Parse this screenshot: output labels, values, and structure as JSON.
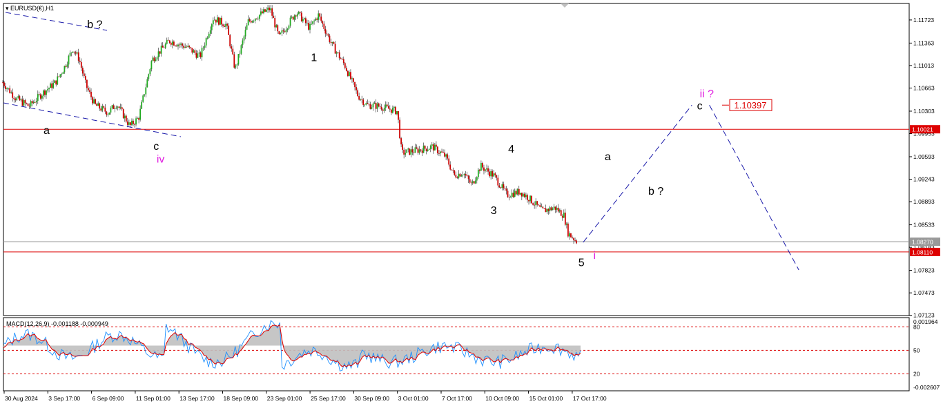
{
  "symbol_title": "EURUSD(€),H1",
  "macd_title": "MACD(12,26,9) -0.001188 -0.000949",
  "chart_data": [
    {
      "type": "candlestick",
      "title": "EURUSD(€),H1",
      "y_ticks": [
        "1.11723",
        "1.11363",
        "1.11013",
        "1.10663",
        "1.10303",
        "1.09953",
        "1.09593",
        "1.09243",
        "1.08893",
        "1.08533",
        "1.08183",
        "1.07823",
        "1.07473",
        "1.07123"
      ],
      "ylim": [
        1.0712,
        1.1198
      ],
      "x_ticks": [
        "30 Aug 2024",
        "3 Sep 17:00",
        "6 Sep 09:00",
        "11 Sep 01:00",
        "13 Sep 17:00",
        "18 Sep 09:00",
        "23 Sep 01:00",
        "25 Sep 17:00",
        "30 Sep 09:00",
        "3 Oct 01:00",
        "7 Oct 17:00",
        "10 Oct 09:00",
        "15 Oct 01:00",
        "17 Oct 17:00"
      ],
      "price_path": [
        [
          0,
          1.1075
        ],
        [
          1.5,
          1.105
        ],
        [
          3,
          1.1038
        ],
        [
          4.5,
          1.1058
        ],
        [
          6,
          1.1075
        ],
        [
          7,
          1.1098
        ],
        [
          8,
          1.1128
        ],
        [
          8.7,
          1.1112
        ],
        [
          9.5,
          1.107
        ],
        [
          10.5,
          1.104
        ],
        [
          12,
          1.1028
        ],
        [
          13,
          1.1042
        ],
        [
          14.5,
          1.1007
        ],
        [
          15.5,
          1.102
        ],
        [
          17,
          1.111
        ],
        [
          19,
          1.114
        ],
        [
          21,
          1.113
        ],
        [
          22.5,
          1.1115
        ],
        [
          24,
          1.1175
        ],
        [
          25.5,
          1.1165
        ],
        [
          26.5,
          1.1095
        ],
        [
          28,
          1.117
        ],
        [
          30.5,
          1.119
        ],
        [
          31.5,
          1.1145
        ],
        [
          33.5,
          1.1185
        ],
        [
          35,
          1.116
        ],
        [
          36,
          1.118
        ],
        [
          37.5,
          1.1135
        ],
        [
          39,
          1.1102
        ],
        [
          40.5,
          1.1055
        ],
        [
          41.5,
          1.104
        ],
        [
          43,
          1.1038
        ],
        [
          45,
          1.103
        ],
        [
          45.5,
          1.0965
        ],
        [
          47.5,
          1.097
        ],
        [
          49,
          1.0975
        ],
        [
          50.5,
          1.096
        ],
        [
          51.5,
          1.093
        ],
        [
          52.5,
          1.0935
        ],
        [
          53.5,
          1.0915
        ],
        [
          54.5,
          1.0945
        ],
        [
          56,
          1.093
        ],
        [
          57.5,
          1.09
        ],
        [
          59,
          1.0905
        ],
        [
          60,
          1.0895
        ],
        [
          61.5,
          1.0875
        ],
        [
          63,
          1.088
        ],
        [
          64,
          1.0868
        ],
        [
          64.5,
          1.084
        ],
        [
          65.5,
          1.0827
        ]
      ],
      "horizontal_levels": [
        {
          "price": 1.10021,
          "label": "1.10021",
          "color": "#dd0000"
        },
        {
          "price": 1.0811,
          "label": "1.08110",
          "color": "#dd0000"
        },
        {
          "price": 1.0827,
          "label": "1.08270",
          "color": "#999999"
        }
      ],
      "target_label": "1.10397",
      "wave_labels": [
        {
          "text": "b ?",
          "x": 10.5,
          "price": 1.116,
          "color": "#000000"
        },
        {
          "text": "a",
          "x": 5,
          "price": 1.0995,
          "color": "#000000"
        },
        {
          "text": "c",
          "x": 17.5,
          "price": 1.097,
          "color": "#000000"
        },
        {
          "text": "iv",
          "x": 18,
          "price": 1.095,
          "color": "#e020e0"
        },
        {
          "text": "1",
          "x": 35.5,
          "price": 1.1108,
          "color": "#000000"
        },
        {
          "text": "4",
          "x": 58,
          "price": 1.0966,
          "color": "#000000"
        },
        {
          "text": "3",
          "x": 56,
          "price": 1.087,
          "color": "#000000"
        },
        {
          "text": "5",
          "x": 66,
          "price": 1.0789,
          "color": "#000000"
        },
        {
          "text": "i",
          "x": 67.5,
          "price": 1.08,
          "color": "#e020e0"
        },
        {
          "text": "a",
          "x": 69,
          "price": 1.0954,
          "color": "#000000"
        },
        {
          "text": "b ?",
          "x": 74.5,
          "price": 1.09,
          "color": "#000000"
        },
        {
          "text": "c",
          "x": 79.5,
          "price": 1.1033,
          "color": "#000000"
        },
        {
          "text": "ii ?",
          "x": 80.3,
          "price": 1.1052,
          "color": "#e020e0"
        }
      ]
    },
    {
      "type": "line",
      "title": "MACD(12,26,9) -0.001188 -0.000949",
      "y_ticks": [
        "0.001964",
        "80",
        "50",
        "20",
        "-0.002607"
      ],
      "levels": [
        80,
        50,
        20
      ],
      "series": [
        {
          "color": "#1e90ff"
        },
        {
          "color": "#dd0000"
        }
      ]
    }
  ],
  "colors": {
    "bull": "#22aa22",
    "bear": "#cc0000",
    "wick": "#222222",
    "forecast": "#1a1aaa",
    "macd_hist": "#c0c0c0"
  }
}
